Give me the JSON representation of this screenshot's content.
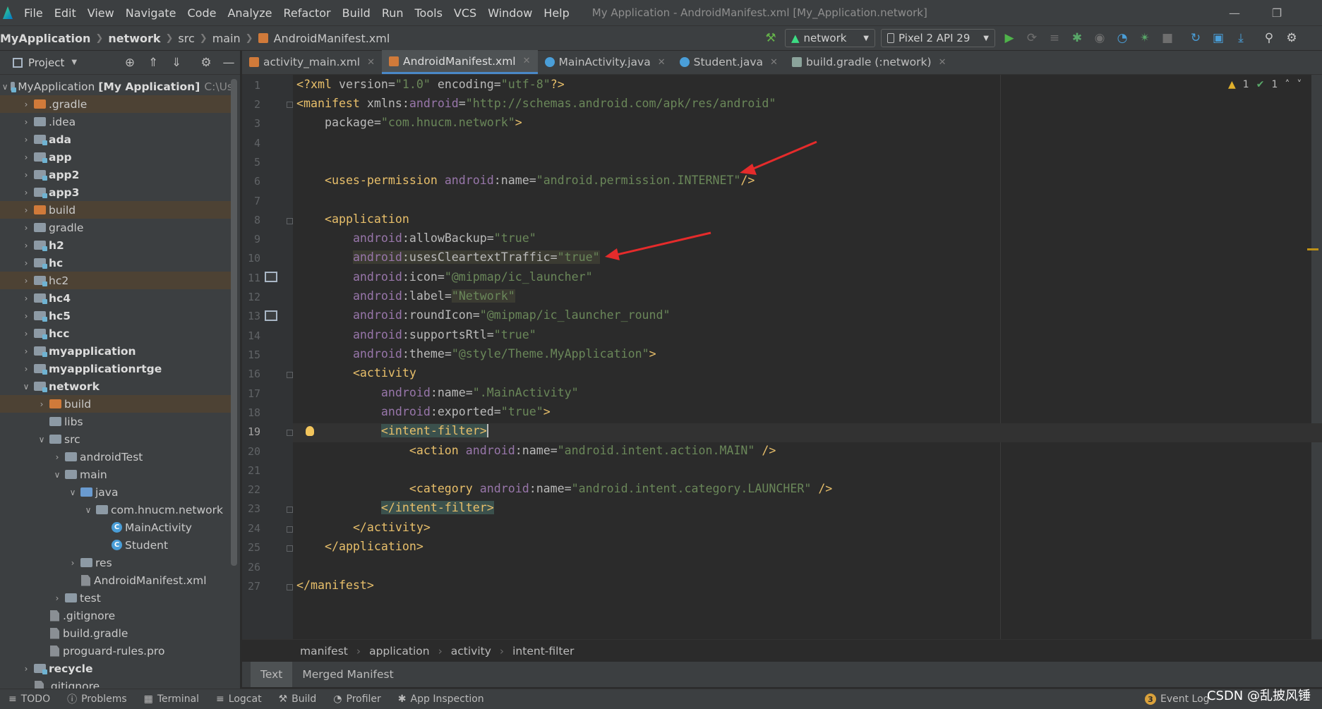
{
  "menubar": {
    "items": [
      "File",
      "Edit",
      "View",
      "Navigate",
      "Code",
      "Analyze",
      "Refactor",
      "Build",
      "Run",
      "Tools",
      "VCS",
      "Window",
      "Help"
    ],
    "window_title": "My Application - AndroidManifest.xml [My_Application.network]"
  },
  "navbar": {
    "crumbs": [
      "MyApplication",
      "network",
      "src",
      "main",
      "AndroidManifest.xml"
    ],
    "run_config": "network",
    "device": "Pixel 2 API 29"
  },
  "project_panel": {
    "title": "Project",
    "tree": [
      {
        "label": "MyApplication",
        "suffix": "[My Application]",
        "path": "C:\\Us",
        "depth": 0,
        "expanded": true,
        "kind": "module",
        "bold": false
      },
      {
        "label": ".gradle",
        "depth": 1,
        "kind": "folder-orange",
        "excluded": true
      },
      {
        "label": ".idea",
        "depth": 1,
        "kind": "folder"
      },
      {
        "label": "ada",
        "depth": 1,
        "kind": "module",
        "bold": true
      },
      {
        "label": "app",
        "depth": 1,
        "kind": "module",
        "bold": true
      },
      {
        "label": "app2",
        "depth": 1,
        "kind": "module",
        "bold": true
      },
      {
        "label": "app3",
        "depth": 1,
        "kind": "module",
        "bold": true
      },
      {
        "label": "build",
        "depth": 1,
        "kind": "folder-orange",
        "excluded": true
      },
      {
        "label": "gradle",
        "depth": 1,
        "kind": "folder"
      },
      {
        "label": "h2",
        "depth": 1,
        "kind": "module",
        "bold": true
      },
      {
        "label": "hc",
        "depth": 1,
        "kind": "module",
        "bold": true
      },
      {
        "label": "hc2",
        "depth": 1,
        "kind": "module",
        "excluded": true
      },
      {
        "label": "hc4",
        "depth": 1,
        "kind": "module",
        "bold": true
      },
      {
        "label": "hc5",
        "depth": 1,
        "kind": "module",
        "bold": true
      },
      {
        "label": "hcc",
        "depth": 1,
        "kind": "module",
        "bold": true
      },
      {
        "label": "myapplication",
        "depth": 1,
        "kind": "module",
        "bold": true
      },
      {
        "label": "myapplicationrtge",
        "depth": 1,
        "kind": "module",
        "bold": true
      },
      {
        "label": "network",
        "depth": 1,
        "kind": "module",
        "bold": true,
        "expanded": true
      },
      {
        "label": "build",
        "depth": 2,
        "kind": "folder-orange",
        "excluded": true
      },
      {
        "label": "libs",
        "depth": 2,
        "kind": "folder",
        "leaf": true
      },
      {
        "label": "src",
        "depth": 2,
        "kind": "folder",
        "expanded": true
      },
      {
        "label": "androidTest",
        "depth": 3,
        "kind": "folder"
      },
      {
        "label": "main",
        "depth": 3,
        "kind": "folder",
        "expanded": true
      },
      {
        "label": "java",
        "depth": 4,
        "kind": "folder-blue",
        "expanded": true
      },
      {
        "label": "com.hnucm.network",
        "depth": 5,
        "kind": "folder",
        "expanded": true
      },
      {
        "label": "MainActivity",
        "depth": 6,
        "kind": "class",
        "leaf": true
      },
      {
        "label": "Student",
        "depth": 6,
        "kind": "class",
        "leaf": true
      },
      {
        "label": "res",
        "depth": 4,
        "kind": "folder"
      },
      {
        "label": "AndroidManifest.xml",
        "depth": 4,
        "kind": "file",
        "leaf": true
      },
      {
        "label": "test",
        "depth": 3,
        "kind": "folder"
      },
      {
        "label": ".gitignore",
        "depth": 2,
        "kind": "file",
        "leaf": true
      },
      {
        "label": "build.gradle",
        "depth": 2,
        "kind": "file",
        "leaf": true
      },
      {
        "label": "proguard-rules.pro",
        "depth": 2,
        "kind": "file",
        "leaf": true
      },
      {
        "label": "recycle",
        "depth": 1,
        "kind": "module",
        "bold": true
      },
      {
        "label": ".gitignore",
        "depth": 1,
        "kind": "file",
        "leaf": true
      }
    ]
  },
  "editor_tabs": [
    {
      "label": "activity_main.xml",
      "icon": "xml-icon",
      "active": false
    },
    {
      "label": "AndroidManifest.xml",
      "icon": "xml-icon",
      "active": true
    },
    {
      "label": "MainActivity.java",
      "icon": "class-icon",
      "active": false
    },
    {
      "label": "Student.java",
      "icon": "class-icon",
      "active": false
    },
    {
      "label": "build.gradle (:network)",
      "icon": "gradle-icon",
      "active": false
    }
  ],
  "inspection": {
    "warnings": "1",
    "weak_warnings": "1"
  },
  "code_lines": [
    "1",
    "2",
    "3",
    "4",
    "5",
    "6",
    "7",
    "8",
    "9",
    "10",
    "11",
    "12",
    "13",
    "14",
    "15",
    "16",
    "17",
    "18",
    "19",
    "20",
    "21",
    "22",
    "23",
    "24",
    "25",
    "26",
    "27"
  ],
  "code": {
    "l1": {
      "a": "<?xml ",
      "b": "version",
      "c": "=",
      "d": "\"1.0\"",
      "e": " encoding",
      "f": "=",
      "g": "\"utf-8\"",
      "h": "?>"
    },
    "l2": {
      "a": "<manifest ",
      "b": "xmlns:",
      "c": "android",
      "d": "=",
      "e": "\"http://schemas.android.com/apk/res/android\""
    },
    "l3": {
      "a": "package",
      "b": "=",
      "c": "\"com.hnucm.network\"",
      "d": ">"
    },
    "l6": {
      "a": "<uses-permission ",
      "b": "android",
      "c": ":name",
      "d": "=",
      "e": "\"android.permission.INTERNET\"",
      "f": "/>"
    },
    "l8": {
      "a": "<application"
    },
    "l9": {
      "a": "android",
      "b": ":allowBackup",
      "c": "=",
      "d": "\"true\""
    },
    "l10": {
      "a": "android",
      "b": ":usesCleartextTraffic",
      "c": "=",
      "d": "\"true\""
    },
    "l11": {
      "a": "android",
      "b": ":icon",
      "c": "=",
      "d": "\"@mipmap/ic_launcher\""
    },
    "l12": {
      "a": "android",
      "b": ":label",
      "c": "=",
      "d": "\"Network\""
    },
    "l13": {
      "a": "android",
      "b": ":roundIcon",
      "c": "=",
      "d": "\"@mipmap/ic_launcher_round\""
    },
    "l14": {
      "a": "android",
      "b": ":supportsRtl",
      "c": "=",
      "d": "\"true\""
    },
    "l15": {
      "a": "android",
      "b": ":theme",
      "c": "=",
      "d": "\"@style/Theme.MyApplication\"",
      "e": ">"
    },
    "l16": {
      "a": "<activity"
    },
    "l17": {
      "a": "android",
      "b": ":name",
      "c": "=",
      "d": "\".MainActivity\""
    },
    "l18": {
      "a": "android",
      "b": ":exported",
      "c": "=",
      "d": "\"true\"",
      "e": ">"
    },
    "l19": {
      "a": "<intent-filter>"
    },
    "l20": {
      "a": "<action ",
      "b": "android",
      "c": ":name",
      "d": "=",
      "e": "\"android.intent.action.MAIN\"",
      "f": " />"
    },
    "l22": {
      "a": "<category ",
      "b": "android",
      "c": ":name",
      "d": "=",
      "e": "\"android.intent.category.LAUNCHER\"",
      "f": " />"
    },
    "l23": {
      "a": "</intent-filter>"
    },
    "l24": {
      "a": "</activity>"
    },
    "l25": {
      "a": "</application>"
    },
    "l27": {
      "a": "</manifest>"
    }
  },
  "editor_breadcrumb": [
    "manifest",
    "application",
    "activity",
    "intent-filter"
  ],
  "mode_tabs": [
    "Text",
    "Merged Manifest"
  ],
  "bottom_tools": [
    "TODO",
    "Problems",
    "Terminal",
    "Logcat",
    "Build",
    "Profiler",
    "App Inspection"
  ],
  "event_log": {
    "count": "3",
    "label": "Event Log"
  },
  "watermark": "CSDN @乱披风锤",
  "colors": {
    "tag": "#e8bf6a",
    "value": "#6a8759",
    "namespace": "#9876aa",
    "annotation_arrow": "#e52b2b"
  }
}
